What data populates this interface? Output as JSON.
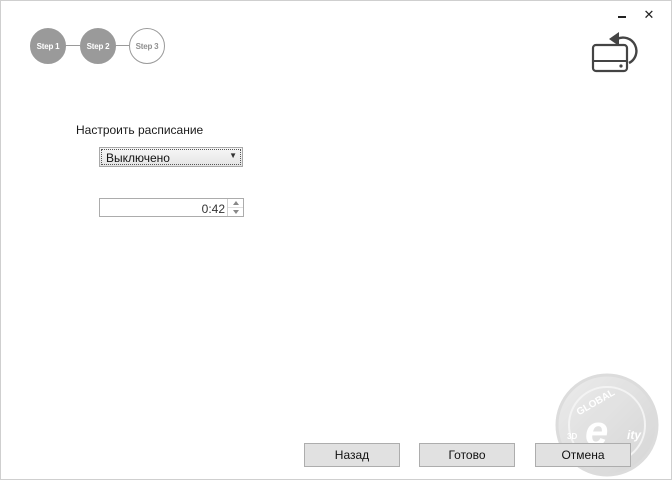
{
  "stepper": {
    "steps": [
      {
        "label": "Step 1",
        "state": "done"
      },
      {
        "label": "Step 2",
        "state": "done"
      },
      {
        "label": "Step 3",
        "state": "current"
      }
    ]
  },
  "window": {
    "close_glyph": "✕",
    "restore_icon": "drive-restore-icon"
  },
  "schedule": {
    "label": "Настроить расписание",
    "selected": "Выключено",
    "time": "0:42"
  },
  "buttons": {
    "back": "Назад",
    "done": "Готово",
    "cancel": "Отмена"
  },
  "watermark": {
    "top_text": "GLOBAL",
    "side_text": "3D",
    "letter": "e",
    "small_text": "ity"
  },
  "colors": {
    "step_done": "#9a9a9a",
    "button_face": "#e1e1e1"
  }
}
